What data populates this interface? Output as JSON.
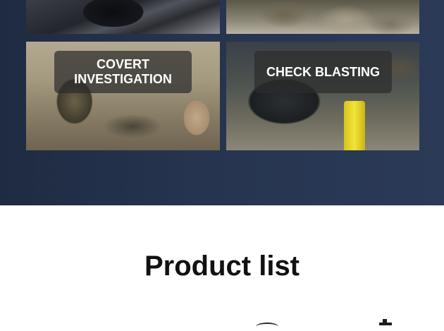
{
  "tiles": {
    "covert": {
      "label": "COVERT INVESTIGATION"
    },
    "check": {
      "label": "CHECK BLASTING"
    }
  },
  "section": {
    "title": "Product list"
  },
  "colors": {
    "dark_band": "#26344f",
    "label_bg": "rgba(45,45,45,0.72)",
    "heading_text": "#111111"
  }
}
